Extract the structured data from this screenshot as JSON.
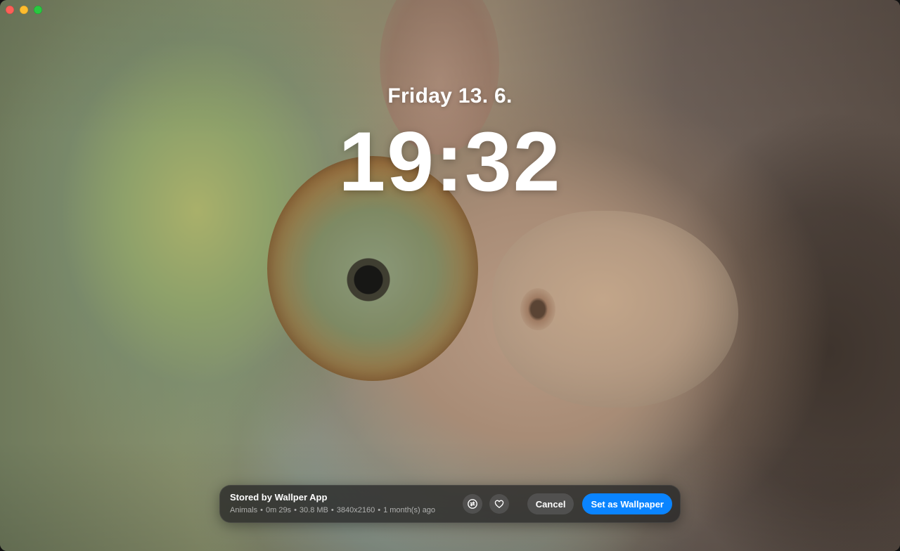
{
  "window": {
    "controls": [
      "close",
      "minimize",
      "zoom"
    ]
  },
  "clock": {
    "date": "Friday 13. 6.",
    "time": "19:32"
  },
  "panel": {
    "title": "Stored by Wallper App",
    "meta": {
      "category": "Animals",
      "duration": "0m 29s",
      "size": "30.8 MB",
      "resolution": "3840x2160",
      "age": "1 month(s) ago"
    },
    "separator": "•",
    "icons": {
      "replace": "replace-icon",
      "favorite": "heart-icon"
    },
    "cancel_label": "Cancel",
    "set_label": "Set as Wallpaper"
  },
  "colors": {
    "accent": "#0a84ff",
    "close": "#fe5f57",
    "minimize": "#febc2e",
    "zoom": "#28c840"
  }
}
